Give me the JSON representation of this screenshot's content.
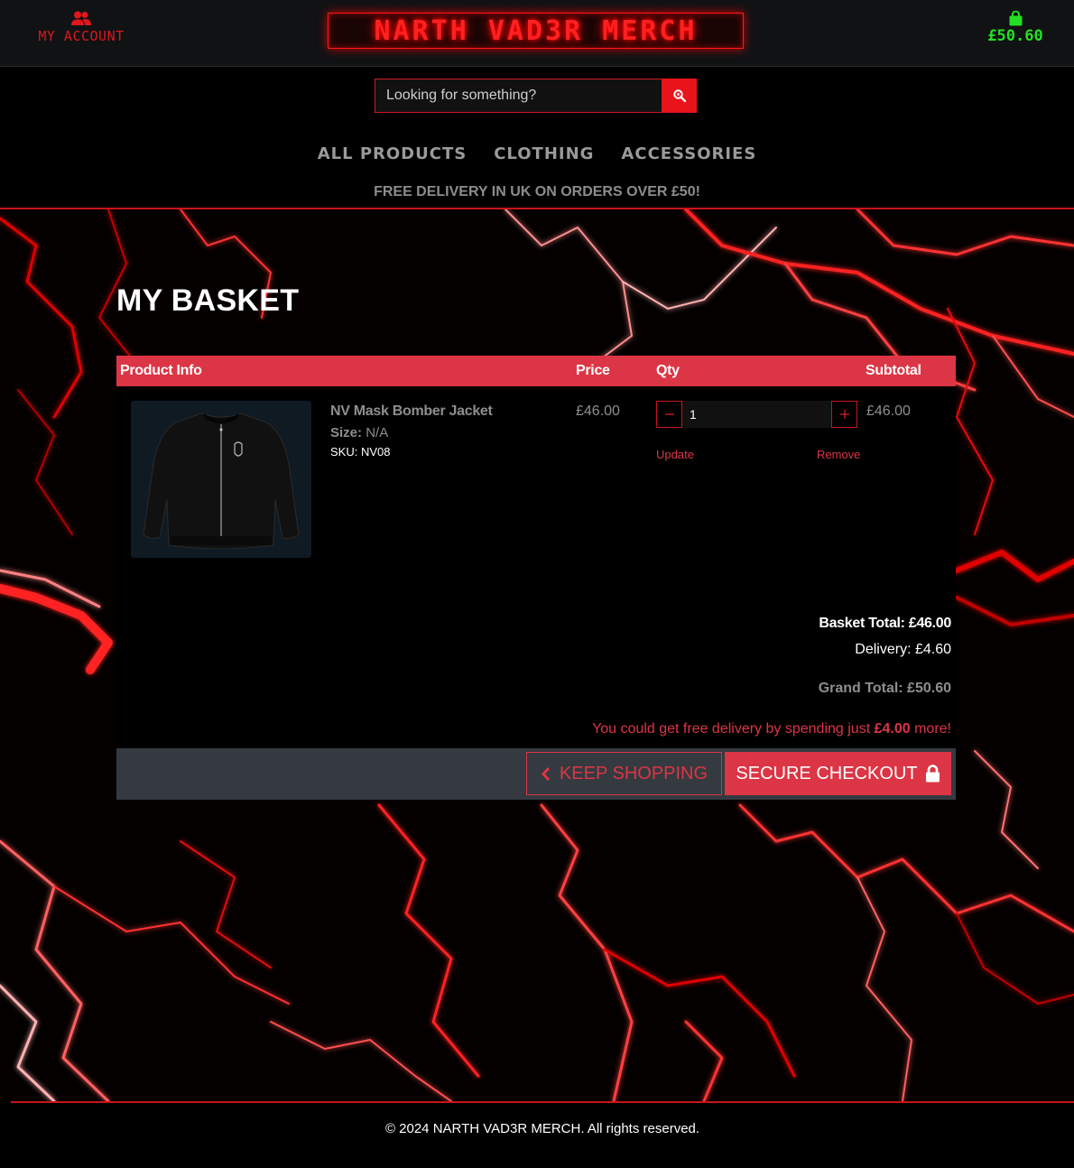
{
  "header": {
    "account_label": "MY ACCOUNT",
    "logo_text": "NARTH VAD3R MERCH",
    "basket_amount": "£50.60",
    "search_placeholder": "Looking for something?",
    "nav": [
      "ALL PRODUCTS",
      "CLOTHING",
      "ACCESSORIES"
    ],
    "banner": "FREE DELIVERY IN UK ON ORDERS OVER £50!"
  },
  "basket": {
    "title": "MY BASKET",
    "columns": {
      "product_info": "Product Info",
      "price": "Price",
      "qty": "Qty",
      "subtotal": "Subtotal"
    },
    "items": [
      {
        "name": "NV Mask Bomber Jacket",
        "size_label": "Size:",
        "size_value": "N/A",
        "sku": "SKU: NV08",
        "price": "£46.00",
        "quantity": "1",
        "subtotal": "£46.00",
        "update_label": "Update",
        "remove_label": "Remove"
      }
    ],
    "basket_total": "Basket Total: £46.00",
    "delivery": "Delivery: £4.60",
    "grand_total": "Grand Total: £50.60",
    "free_delivery_prefix": "You could get free delivery by spending just",
    "free_delivery_amount": "£4.00",
    "free_delivery_suffix": "more!",
    "keep_shopping_label": "KEEP SHOPPING",
    "checkout_label": "SECURE CHECKOUT"
  },
  "footer": {
    "copyright": "© 2024 NARTH VAD3R MERCH. All rights reserved."
  },
  "colors": {
    "accent_red": "#dc3545",
    "neon_red": "#ff2020",
    "basket_green": "#24e024",
    "actions_bar": "#343a40"
  },
  "icons": [
    "users-icon",
    "shopping-bag-icon",
    "search-icon",
    "chevron-left-icon",
    "lock-icon",
    "minus-icon",
    "plus-icon"
  ]
}
